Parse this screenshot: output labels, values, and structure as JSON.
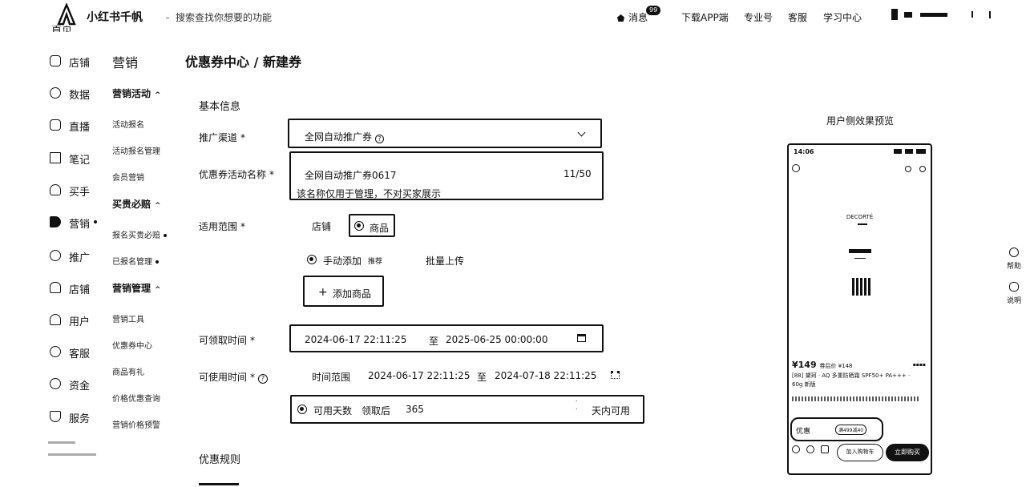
{
  "topbar": {
    "logo": "小红书千帆",
    "search_hint": "搜索查找你想要的功能",
    "nav": {
      "messages": "消息",
      "badge": "99",
      "download": "下载APP端",
      "pro": "专业号",
      "service": "客服",
      "study": "学习中心"
    }
  },
  "leftnav": {
    "items": [
      {
        "label": "店铺",
        "icon": "store-icon"
      },
      {
        "label": "数据",
        "icon": "chart-icon"
      },
      {
        "label": "直播",
        "icon": "play-icon"
      },
      {
        "label": "笔记",
        "icon": "book-icon"
      },
      {
        "label": "买手",
        "icon": "bag-icon"
      },
      {
        "label": "营销",
        "icon": "megaphone-icon",
        "active": true
      },
      {
        "label": "推广",
        "icon": "people-icon"
      },
      {
        "label": "店铺",
        "icon": "storefront-icon"
      },
      {
        "label": "用户",
        "icon": "user-icon"
      },
      {
        "label": "客服",
        "icon": "headset-icon"
      },
      {
        "label": "资金",
        "icon": "money-icon"
      },
      {
        "label": "服务",
        "icon": "shield-icon"
      }
    ]
  },
  "subnav": {
    "title": "营销",
    "groups": [
      {
        "label": "营销活动",
        "items": [
          "活动报名",
          "活动报名管理",
          "会员营销"
        ]
      },
      {
        "label": "买贵必赔",
        "items": [
          "报名买贵必赔",
          "已报名管理"
        ]
      },
      {
        "label": "营销管理",
        "items": [
          "营销工具",
          "优惠券中心",
          "商品有礼",
          "价格优惠查询",
          "营销价格预警"
        ]
      }
    ]
  },
  "breadcrumb": "优惠券中心 / 新建券",
  "form": {
    "section_basic": "基本信息",
    "channel_label": "推广渠道",
    "channel_value": "全网自动推广券",
    "name_label": "优惠券活动名称",
    "name_value": "全网自动推广券0617",
    "name_counter": "11/50",
    "name_help": "该名称仅用于管理，不对买家展示",
    "scope_label": "适用范围",
    "scope_store": "店铺",
    "scope_product": "商品",
    "add_manual": "手动添加",
    "add_manual_tag": "推荐",
    "add_batch": "批量上传",
    "add_product_btn": "添加商品",
    "claim_label": "可领取时间",
    "claim_start": "2024-06-17 22:11:25",
    "claim_sep": "至",
    "claim_end": "2025-06-25 00:00:00",
    "use_label": "可使用时间",
    "use_range_label": "时间范围",
    "use_start": "2024-06-17 22:11:25",
    "use_sep": "至",
    "use_end": "2024-07-18 22:11:25",
    "days_label": "可用天数",
    "days_prefix": "领取后",
    "days_value": "365",
    "days_suffix": "天内可用",
    "section_rules": "优惠规则"
  },
  "preview": {
    "label": "用户侧效果预览",
    "time": "14:06",
    "brand": "DECORTÉ",
    "price": "¥149",
    "price_note": "券后价 ¥148",
    "product_name": "[88] 黛珂 · AQ 多重防晒霜 SPF50+ PA+++ · 60g 新版",
    "coupon_label": "优惠",
    "coupon_tag": "满499减40",
    "cart_btn": "加入购物车",
    "buy_btn": "立即购买"
  },
  "float_tools": [
    "帮助",
    "说明"
  ]
}
